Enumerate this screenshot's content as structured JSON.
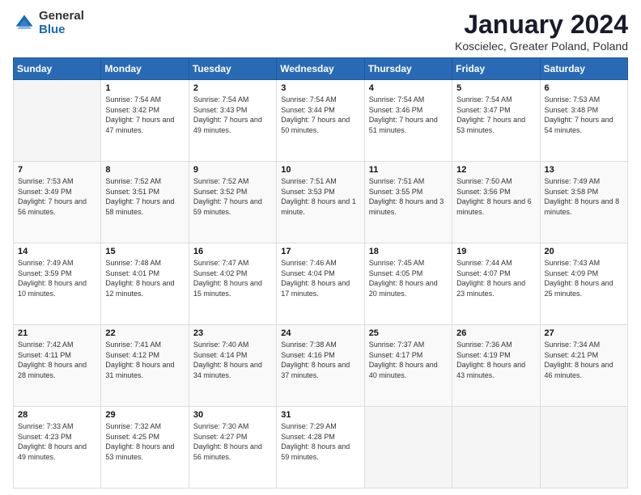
{
  "header": {
    "logo_general": "General",
    "logo_blue": "Blue",
    "title": "January 2024",
    "subtitle": "Koscielec, Greater Poland, Poland"
  },
  "weekdays": [
    "Sunday",
    "Monday",
    "Tuesday",
    "Wednesday",
    "Thursday",
    "Friday",
    "Saturday"
  ],
  "weeks": [
    [
      {
        "day": "",
        "sunrise": "",
        "sunset": "",
        "daylight": ""
      },
      {
        "day": "1",
        "sunrise": "Sunrise: 7:54 AM",
        "sunset": "Sunset: 3:42 PM",
        "daylight": "Daylight: 7 hours and 47 minutes."
      },
      {
        "day": "2",
        "sunrise": "Sunrise: 7:54 AM",
        "sunset": "Sunset: 3:43 PM",
        "daylight": "Daylight: 7 hours and 49 minutes."
      },
      {
        "day": "3",
        "sunrise": "Sunrise: 7:54 AM",
        "sunset": "Sunset: 3:44 PM",
        "daylight": "Daylight: 7 hours and 50 minutes."
      },
      {
        "day": "4",
        "sunrise": "Sunrise: 7:54 AM",
        "sunset": "Sunset: 3:46 PM",
        "daylight": "Daylight: 7 hours and 51 minutes."
      },
      {
        "day": "5",
        "sunrise": "Sunrise: 7:54 AM",
        "sunset": "Sunset: 3:47 PM",
        "daylight": "Daylight: 7 hours and 53 minutes."
      },
      {
        "day": "6",
        "sunrise": "Sunrise: 7:53 AM",
        "sunset": "Sunset: 3:48 PM",
        "daylight": "Daylight: 7 hours and 54 minutes."
      }
    ],
    [
      {
        "day": "7",
        "sunrise": "Sunrise: 7:53 AM",
        "sunset": "Sunset: 3:49 PM",
        "daylight": "Daylight: 7 hours and 56 minutes."
      },
      {
        "day": "8",
        "sunrise": "Sunrise: 7:52 AM",
        "sunset": "Sunset: 3:51 PM",
        "daylight": "Daylight: 7 hours and 58 minutes."
      },
      {
        "day": "9",
        "sunrise": "Sunrise: 7:52 AM",
        "sunset": "Sunset: 3:52 PM",
        "daylight": "Daylight: 7 hours and 59 minutes."
      },
      {
        "day": "10",
        "sunrise": "Sunrise: 7:51 AM",
        "sunset": "Sunset: 3:53 PM",
        "daylight": "Daylight: 8 hours and 1 minute."
      },
      {
        "day": "11",
        "sunrise": "Sunrise: 7:51 AM",
        "sunset": "Sunset: 3:55 PM",
        "daylight": "Daylight: 8 hours and 3 minutes."
      },
      {
        "day": "12",
        "sunrise": "Sunrise: 7:50 AM",
        "sunset": "Sunset: 3:56 PM",
        "daylight": "Daylight: 8 hours and 6 minutes."
      },
      {
        "day": "13",
        "sunrise": "Sunrise: 7:49 AM",
        "sunset": "Sunset: 3:58 PM",
        "daylight": "Daylight: 8 hours and 8 minutes."
      }
    ],
    [
      {
        "day": "14",
        "sunrise": "Sunrise: 7:49 AM",
        "sunset": "Sunset: 3:59 PM",
        "daylight": "Daylight: 8 hours and 10 minutes."
      },
      {
        "day": "15",
        "sunrise": "Sunrise: 7:48 AM",
        "sunset": "Sunset: 4:01 PM",
        "daylight": "Daylight: 8 hours and 12 minutes."
      },
      {
        "day": "16",
        "sunrise": "Sunrise: 7:47 AM",
        "sunset": "Sunset: 4:02 PM",
        "daylight": "Daylight: 8 hours and 15 minutes."
      },
      {
        "day": "17",
        "sunrise": "Sunrise: 7:46 AM",
        "sunset": "Sunset: 4:04 PM",
        "daylight": "Daylight: 8 hours and 17 minutes."
      },
      {
        "day": "18",
        "sunrise": "Sunrise: 7:45 AM",
        "sunset": "Sunset: 4:05 PM",
        "daylight": "Daylight: 8 hours and 20 minutes."
      },
      {
        "day": "19",
        "sunrise": "Sunrise: 7:44 AM",
        "sunset": "Sunset: 4:07 PM",
        "daylight": "Daylight: 8 hours and 23 minutes."
      },
      {
        "day": "20",
        "sunrise": "Sunrise: 7:43 AM",
        "sunset": "Sunset: 4:09 PM",
        "daylight": "Daylight: 8 hours and 25 minutes."
      }
    ],
    [
      {
        "day": "21",
        "sunrise": "Sunrise: 7:42 AM",
        "sunset": "Sunset: 4:11 PM",
        "daylight": "Daylight: 8 hours and 28 minutes."
      },
      {
        "day": "22",
        "sunrise": "Sunrise: 7:41 AM",
        "sunset": "Sunset: 4:12 PM",
        "daylight": "Daylight: 8 hours and 31 minutes."
      },
      {
        "day": "23",
        "sunrise": "Sunrise: 7:40 AM",
        "sunset": "Sunset: 4:14 PM",
        "daylight": "Daylight: 8 hours and 34 minutes."
      },
      {
        "day": "24",
        "sunrise": "Sunrise: 7:38 AM",
        "sunset": "Sunset: 4:16 PM",
        "daylight": "Daylight: 8 hours and 37 minutes."
      },
      {
        "day": "25",
        "sunrise": "Sunrise: 7:37 AM",
        "sunset": "Sunset: 4:17 PM",
        "daylight": "Daylight: 8 hours and 40 minutes."
      },
      {
        "day": "26",
        "sunrise": "Sunrise: 7:36 AM",
        "sunset": "Sunset: 4:19 PM",
        "daylight": "Daylight: 8 hours and 43 minutes."
      },
      {
        "day": "27",
        "sunrise": "Sunrise: 7:34 AM",
        "sunset": "Sunset: 4:21 PM",
        "daylight": "Daylight: 8 hours and 46 minutes."
      }
    ],
    [
      {
        "day": "28",
        "sunrise": "Sunrise: 7:33 AM",
        "sunset": "Sunset: 4:23 PM",
        "daylight": "Daylight: 8 hours and 49 minutes."
      },
      {
        "day": "29",
        "sunrise": "Sunrise: 7:32 AM",
        "sunset": "Sunset: 4:25 PM",
        "daylight": "Daylight: 8 hours and 53 minutes."
      },
      {
        "day": "30",
        "sunrise": "Sunrise: 7:30 AM",
        "sunset": "Sunset: 4:27 PM",
        "daylight": "Daylight: 8 hours and 56 minutes."
      },
      {
        "day": "31",
        "sunrise": "Sunrise: 7:29 AM",
        "sunset": "Sunset: 4:28 PM",
        "daylight": "Daylight: 8 hours and 59 minutes."
      },
      {
        "day": "",
        "sunrise": "",
        "sunset": "",
        "daylight": ""
      },
      {
        "day": "",
        "sunrise": "",
        "sunset": "",
        "daylight": ""
      },
      {
        "day": "",
        "sunrise": "",
        "sunset": "",
        "daylight": ""
      }
    ]
  ]
}
